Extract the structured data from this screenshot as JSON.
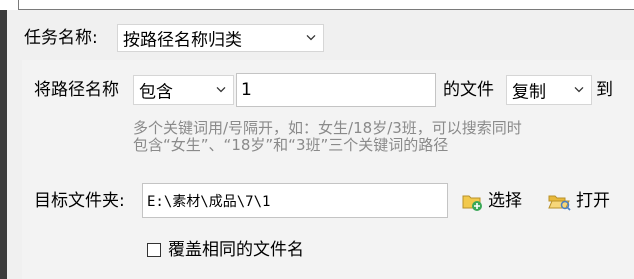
{
  "task_name": {
    "label": "任务名称:",
    "selected": "按路径名称归类"
  },
  "rule": {
    "label": "将路径名称",
    "match_selected": "包含",
    "keyword_value": "1",
    "file_label": "的文件",
    "action_selected": "复制",
    "to_label": "到"
  },
  "hint": {
    "line1": "多个关键词用/号隔开，如：女生/18岁/3班，可以搜索同时",
    "line2": "包含“女生”、“18岁”和“3班”三个关键词的路径"
  },
  "target": {
    "label": "目标文件夹:",
    "value": "E:\\素材\\成品\\7\\1",
    "select_label": "选择",
    "open_label": "打开"
  },
  "overwrite": {
    "label": "覆盖相同的文件名",
    "checked": false
  }
}
